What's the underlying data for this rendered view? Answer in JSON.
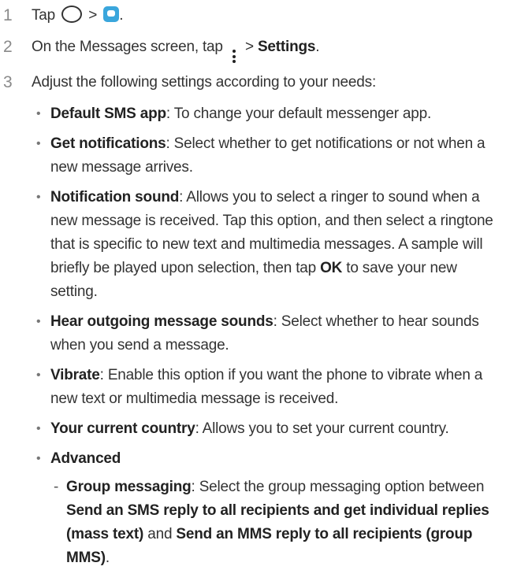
{
  "steps": [
    {
      "num": "1",
      "text_a": "Tap ",
      "text_b": " > ",
      "text_c": "."
    },
    {
      "num": "2",
      "text_a": "On the Messages screen, tap ",
      "text_b": " > ",
      "bold": "Settings",
      "text_c": "."
    },
    {
      "num": "3",
      "text": "Adjust the following settings according to your needs:",
      "bullets": [
        {
          "term": "Default SMS app",
          "desc": ": To change your default messenger app."
        },
        {
          "term": "Get notifications",
          "desc": ": Select whether to get notifications or not when a new message arrives."
        },
        {
          "term": "Notification sound",
          "desc_a": ": Allows you to select a ringer to sound when a new message is received. Tap this option, and then select a ringtone that is specific to new text and multimedia messages. A sample will briefly be played upon selection, then tap ",
          "ok": "OK",
          "desc_b": " to save your new setting."
        },
        {
          "term": "Hear outgoing message sounds",
          "desc": ": Select whether to hear sounds when you send a message."
        },
        {
          "term": "Vibrate",
          "desc": ": Enable this option if you want the phone to vibrate when a new text or multimedia message is received."
        },
        {
          "term": "Your current country",
          "desc": ": Allows you to set your current country."
        },
        {
          "term": "Advanced",
          "sub": [
            {
              "term": "Group messaging",
              "desc_a": ": Select the group messaging option between ",
              "opt1": "Send an SMS reply to all recipients and get individual replies (mass text)",
              "desc_b": " and ",
              "opt2": "Send an MMS reply to all recipients (group MMS)",
              "desc_c": "."
            }
          ]
        }
      ]
    }
  ],
  "icons": {
    "home": "home-circle-icon",
    "messages": "messages-app-icon",
    "more": "more-options-icon"
  },
  "colors": {
    "messages_icon": "#3aa6dc",
    "text": "#333333",
    "step_number": "#8a8a8a"
  }
}
